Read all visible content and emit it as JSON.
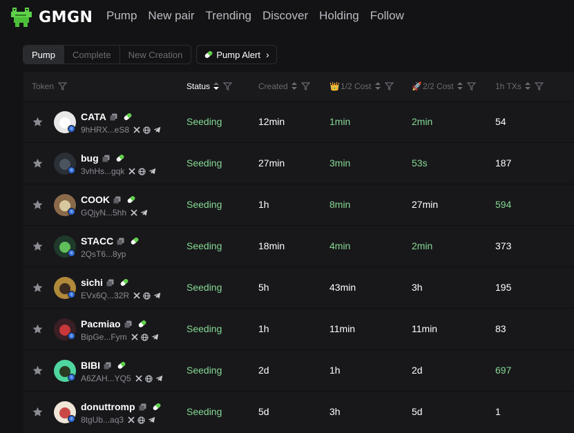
{
  "brand": {
    "name": "GMGN"
  },
  "nav": [
    "Pump",
    "New pair",
    "Trending",
    "Discover",
    "Holding",
    "Follow"
  ],
  "tabs": [
    "Pump",
    "Complete",
    "New Creation"
  ],
  "pump_alert": {
    "label": "Pump Alert"
  },
  "columns": {
    "token": "Token",
    "status": "Status",
    "created": "Created",
    "half_cost": "1/2 Cost",
    "full_cost": "2/2 Cost",
    "txs": "1h TXs"
  },
  "rows": [
    {
      "symbol": "CATA",
      "address": "9hHRX...eS8",
      "socials": [
        "x",
        "web",
        "telegram"
      ],
      "status": "Seeding",
      "created": "12min",
      "half_cost": "1min",
      "half_green": true,
      "full_cost": "2min",
      "full_green": true,
      "txs": "54",
      "txs_green": false
    },
    {
      "symbol": "bug",
      "address": "3vhHs...gqk",
      "socials": [
        "x",
        "web",
        "telegram"
      ],
      "status": "Seeding",
      "created": "27min",
      "half_cost": "3min",
      "half_green": true,
      "full_cost": "53s",
      "full_green": true,
      "txs": "187",
      "txs_green": false
    },
    {
      "symbol": "COOK",
      "address": "GQjyN...5hh",
      "socials": [
        "x",
        "telegram"
      ],
      "status": "Seeding",
      "created": "1h",
      "half_cost": "8min",
      "half_green": true,
      "full_cost": "27min",
      "full_green": false,
      "txs": "594",
      "txs_green": true
    },
    {
      "symbol": "STACC",
      "address": "2QsT6...8yp",
      "socials": [],
      "status": "Seeding",
      "created": "18min",
      "half_cost": "4min",
      "half_green": true,
      "full_cost": "2min",
      "full_green": true,
      "txs": "373",
      "txs_green": false
    },
    {
      "symbol": "sichi",
      "address": "EVx6Q...32R",
      "socials": [
        "x",
        "web",
        "telegram"
      ],
      "status": "Seeding",
      "created": "5h",
      "half_cost": "43min",
      "half_green": false,
      "full_cost": "3h",
      "full_green": false,
      "txs": "195",
      "txs_green": false
    },
    {
      "symbol": "Pacmiao",
      "address": "BipGe...Fym",
      "socials": [
        "x",
        "web",
        "telegram"
      ],
      "status": "Seeding",
      "created": "1h",
      "half_cost": "11min",
      "half_green": false,
      "full_cost": "11min",
      "full_green": false,
      "txs": "83",
      "txs_green": false
    },
    {
      "symbol": "BIBI",
      "address": "A6ZAH...YQ5",
      "socials": [
        "x",
        "web",
        "telegram"
      ],
      "status": "Seeding",
      "created": "2d",
      "half_cost": "1h",
      "half_green": false,
      "full_cost": "2d",
      "full_green": false,
      "txs": "697",
      "txs_green": true
    },
    {
      "symbol": "donuttromp",
      "address": "8tgUb...aq3",
      "socials": [
        "x",
        "web",
        "telegram"
      ],
      "status": "Seeding",
      "created": "5d",
      "half_cost": "3h",
      "half_green": false,
      "full_cost": "5d",
      "full_green": false,
      "txs": "1",
      "txs_green": false
    }
  ],
  "colors": {
    "green": "#86d993",
    "background": "#131315",
    "row": "#18181b",
    "badge": "#2e6bd7"
  }
}
